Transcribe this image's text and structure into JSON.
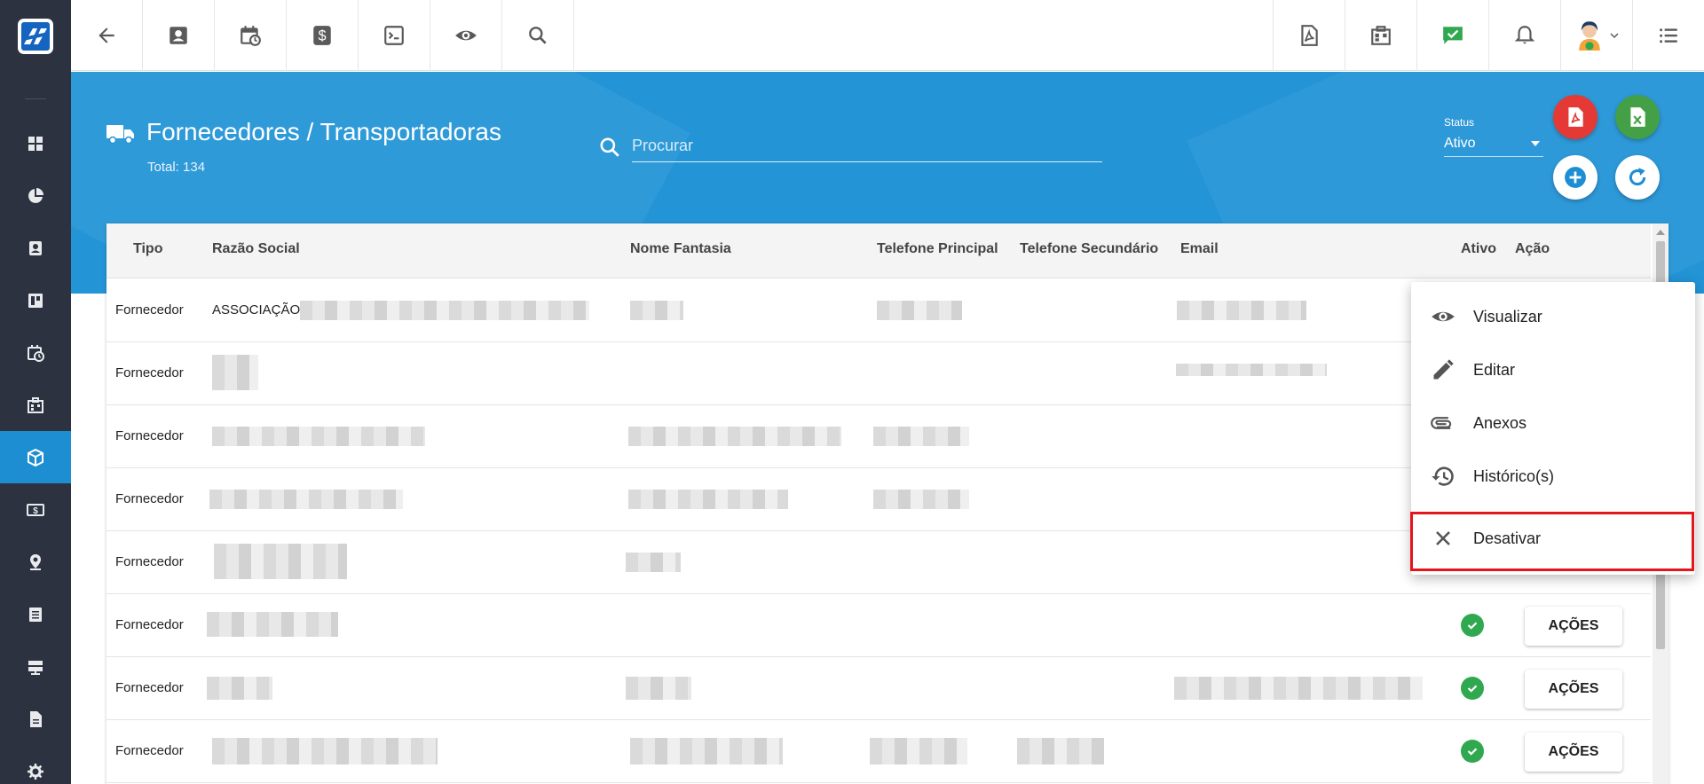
{
  "toolbar": {
    "left": [
      "back-icon",
      "contacts-icon",
      "calendar-icon",
      "money-icon",
      "terminal-icon",
      "eye-icon",
      "search-icon"
    ],
    "right": [
      "pdf-icon",
      "building-icon",
      "chat-check-icon",
      "bell-icon",
      "avatar",
      "list-icon"
    ]
  },
  "sidebar": {
    "items": [
      "dashboard-icon",
      "pie-chart-icon",
      "contacts-icon",
      "board-icon",
      "calendar-icon",
      "building-icon",
      "package-icon",
      "money-icon",
      "location-icon",
      "document-icon",
      "server-icon",
      "file-icon",
      "gear-icon"
    ],
    "active_index": 6
  },
  "header": {
    "title": "Fornecedores / Transportadoras",
    "total": "Total: 134",
    "search_placeholder": "Procurar",
    "status_label": "Status",
    "status_value": "Ativo"
  },
  "table": {
    "columns": [
      "Tipo",
      "Razão Social",
      "Nome Fantasia",
      "Telefone Principal",
      "Telefone Secundário",
      "Email",
      "Ativo",
      "Ação"
    ],
    "rows": [
      {
        "tipo": "Fornecedor",
        "razao": "ASSOCIAÇÃO"
      },
      {
        "tipo": "Fornecedor",
        "razao": ""
      },
      {
        "tipo": "Fornecedor",
        "razao": ""
      },
      {
        "tipo": "Fornecedor",
        "razao": ""
      },
      {
        "tipo": "Fornecedor",
        "razao": ""
      },
      {
        "tipo": "Fornecedor",
        "razao": ""
      },
      {
        "tipo": "Fornecedor",
        "razao": ""
      },
      {
        "tipo": "Fornecedor",
        "razao": ""
      }
    ],
    "action_label": "AÇÕES"
  },
  "menu": {
    "items": [
      {
        "label": "Visualizar",
        "icon": "eye-icon"
      },
      {
        "label": "Editar",
        "icon": "pencil-icon"
      },
      {
        "label": "Anexos",
        "icon": "paperclip-icon"
      },
      {
        "label": "Histórico(s)",
        "icon": "history-icon"
      },
      {
        "label": "Desativar",
        "icon": "close-icon"
      }
    ]
  },
  "colors": {
    "sidebar": "#2c323f",
    "header": "#2394d6",
    "active": "#1d8ed1",
    "pdf_fab": "#e53935",
    "excel_fab": "#43a047",
    "check": "#2fa84f",
    "highlight": "#e3161d"
  }
}
